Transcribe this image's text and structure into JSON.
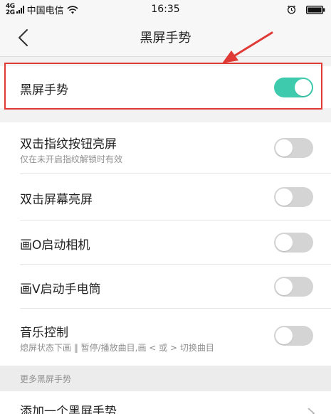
{
  "status_bar": {
    "signal_label": "4G",
    "signal_sub": "2G",
    "carrier": "中国电信",
    "time": "16:35",
    "icons": [
      "signal-icon",
      "wifi-icon",
      "alarm-icon",
      "battery-icon"
    ]
  },
  "nav": {
    "title": "黑屏手势",
    "back_icon": "chevron-left-icon"
  },
  "main_toggle": {
    "label": "黑屏手势",
    "on": true
  },
  "settings": [
    {
      "label": "双击指纹按钮亮屏",
      "sub": "仅在未开启指纹解锁时有效",
      "on": false
    },
    {
      "label": "双击屏幕亮屏",
      "sub": "",
      "on": false
    },
    {
      "label": "画O启动相机",
      "sub": "",
      "on": false
    },
    {
      "label": "画V启动手电筒",
      "sub": "",
      "on": false
    },
    {
      "label": "音乐控制",
      "sub": "熄屏状态下画 ‖ 暂停/播放曲目,画 < 或 > 切换曲目",
      "on": false
    }
  ],
  "more_section": {
    "header": "更多黑屏手势",
    "add_label": "添加一个黑屏手势"
  },
  "colors": {
    "toggle_on": "#3ecbad",
    "toggle_off": "#d4d4d4",
    "annotation": "#e03a36"
  }
}
